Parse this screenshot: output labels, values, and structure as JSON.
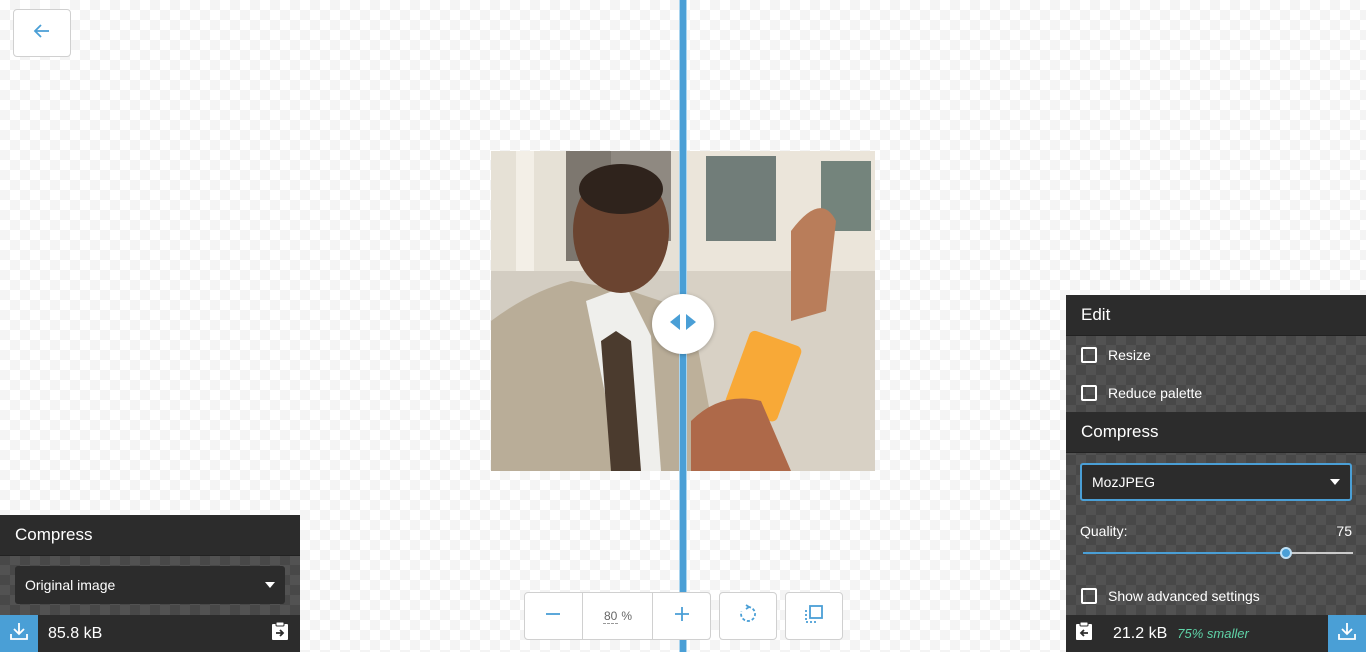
{
  "toolbar": {
    "back_icon": "arrow-left-icon",
    "zoom": {
      "minus_icon": "minus-icon",
      "value": "80",
      "unit": "%",
      "plus_icon": "plus-icon"
    },
    "rotate_icon": "rotate-icon",
    "background_toggle_icon": "background-toggle-icon"
  },
  "left_panel": {
    "header": "Compress",
    "method": "Original image",
    "download_icon": "download-icon",
    "size": "85.8 kB",
    "copy_icon": "copy-settings-icon"
  },
  "right_panel": {
    "edit_header": "Edit",
    "resize_label": "Resize",
    "resize_checked": false,
    "reduce_palette_label": "Reduce palette",
    "reduce_palette_checked": false,
    "compress_header": "Compress",
    "method": "MozJPEG",
    "quality_label": "Quality:",
    "quality_value": "75",
    "quality_fraction": 0.75,
    "advanced_label": "Show advanced settings",
    "advanced_checked": false,
    "copy_icon": "copy-settings-icon",
    "size": "21.2 kB",
    "savings": "75% smaller",
    "download_icon": "download-icon"
  },
  "colors": {
    "accent": "#4a9fd6",
    "panel_dark": "#2c2c2c",
    "savings_green": "#5fd3a7"
  }
}
